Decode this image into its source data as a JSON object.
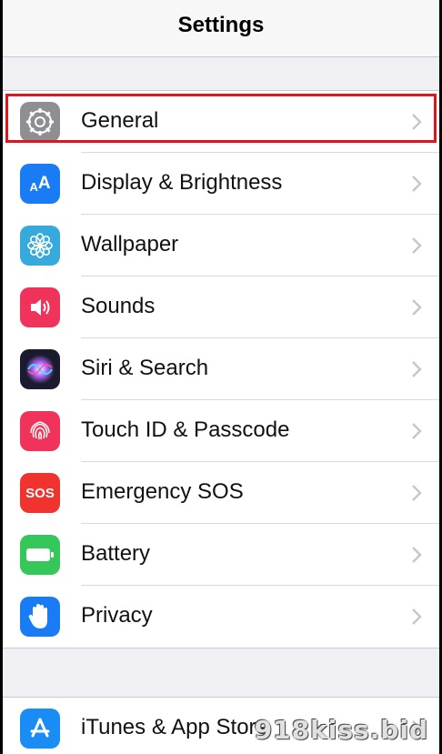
{
  "nav": {
    "title": "Settings"
  },
  "colors": {
    "highlight": "#e0141e",
    "accent": "#007aff"
  },
  "group1": [
    {
      "label": "General",
      "icon": "gear-icon",
      "color": "#8e8e93",
      "highlighted": true
    },
    {
      "label": "Display & Brightness",
      "icon": "text-size-icon",
      "color": "#1a7cf5"
    },
    {
      "label": "Wallpaper",
      "icon": "flower-icon",
      "color": "#36aadc"
    },
    {
      "label": "Sounds",
      "icon": "speaker-icon",
      "color": "#f0335a"
    },
    {
      "label": "Siri & Search",
      "icon": "siri-icon",
      "color": "#1b1b2f"
    },
    {
      "label": "Touch ID & Passcode",
      "icon": "fingerprint-icon",
      "color": "#f0335a"
    },
    {
      "label": "Emergency SOS",
      "icon": "sos-icon",
      "color": "#f0332f",
      "icon_text": "SOS"
    },
    {
      "label": "Battery",
      "icon": "battery-icon",
      "color": "#35c759"
    },
    {
      "label": "Privacy",
      "icon": "hand-icon",
      "color": "#1a7cf5"
    }
  ],
  "group2": [
    {
      "label": "iTunes & App Store",
      "icon": "app-store-icon",
      "color": "#1a8cf5"
    }
  ],
  "watermark": "918kiss.bid"
}
